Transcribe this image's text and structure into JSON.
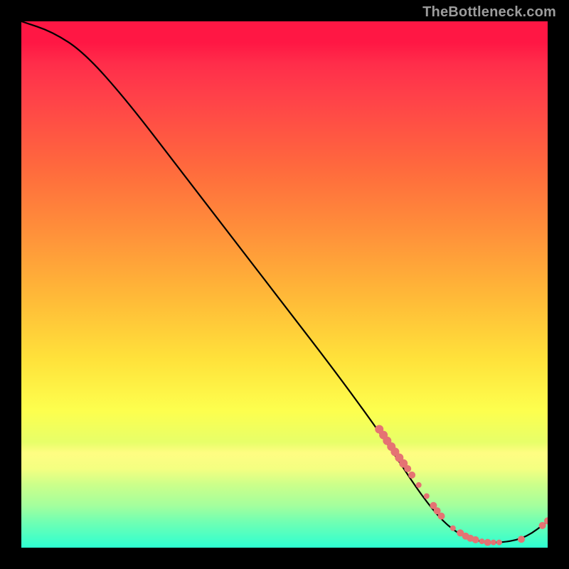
{
  "watermark": "TheBottleneck.com",
  "colors": {
    "background": "#000000",
    "dot": "#e57373",
    "line": "#000000",
    "watermark": "#9c9c9c",
    "gradient_top": "#ff1744",
    "gradient_bottom": "#2effd1"
  },
  "chart_data": {
    "type": "line",
    "title": "",
    "xlabel": "",
    "ylabel": "",
    "xlim": [
      0,
      100
    ],
    "ylim": [
      0,
      100
    ],
    "curve": [
      {
        "x": 0,
        "y": 100
      },
      {
        "x": 6,
        "y": 98
      },
      {
        "x": 12,
        "y": 94
      },
      {
        "x": 20,
        "y": 85
      },
      {
        "x": 30,
        "y": 72
      },
      {
        "x": 40,
        "y": 59
      },
      {
        "x": 50,
        "y": 46
      },
      {
        "x": 60,
        "y": 33
      },
      {
        "x": 68,
        "y": 22
      },
      {
        "x": 72,
        "y": 16
      },
      {
        "x": 76,
        "y": 10
      },
      {
        "x": 80,
        "y": 5
      },
      {
        "x": 84,
        "y": 2
      },
      {
        "x": 88,
        "y": 1
      },
      {
        "x": 92,
        "y": 1
      },
      {
        "x": 96,
        "y": 2
      },
      {
        "x": 100,
        "y": 5
      }
    ],
    "dots": [
      {
        "x": 68.0,
        "y": 22.5,
        "r": 6
      },
      {
        "x": 68.8,
        "y": 21.4,
        "r": 6
      },
      {
        "x": 69.5,
        "y": 20.3,
        "r": 6
      },
      {
        "x": 70.3,
        "y": 19.2,
        "r": 6
      },
      {
        "x": 71.0,
        "y": 18.2,
        "r": 6
      },
      {
        "x": 71.8,
        "y": 17.1,
        "r": 6
      },
      {
        "x": 72.6,
        "y": 16.0,
        "r": 6
      },
      {
        "x": 73.4,
        "y": 15.0,
        "r": 5
      },
      {
        "x": 74.2,
        "y": 13.8,
        "r": 5
      },
      {
        "x": 75.5,
        "y": 11.9,
        "r": 4
      },
      {
        "x": 77.0,
        "y": 9.8,
        "r": 4
      },
      {
        "x": 78.3,
        "y": 8.0,
        "r": 5
      },
      {
        "x": 79.0,
        "y": 7.0,
        "r": 5
      },
      {
        "x": 79.8,
        "y": 6.0,
        "r": 5
      },
      {
        "x": 82.0,
        "y": 3.7,
        "r": 4
      },
      {
        "x": 83.4,
        "y": 2.8,
        "r": 5
      },
      {
        "x": 84.4,
        "y": 2.2,
        "r": 5
      },
      {
        "x": 85.3,
        "y": 1.8,
        "r": 5
      },
      {
        "x": 86.3,
        "y": 1.5,
        "r": 5
      },
      {
        "x": 87.5,
        "y": 1.2,
        "r": 4
      },
      {
        "x": 88.6,
        "y": 1.0,
        "r": 5
      },
      {
        "x": 89.7,
        "y": 1.0,
        "r": 4
      },
      {
        "x": 90.8,
        "y": 1.0,
        "r": 4
      },
      {
        "x": 95.0,
        "y": 1.6,
        "r": 5
      },
      {
        "x": 99.0,
        "y": 4.2,
        "r": 5
      },
      {
        "x": 100.0,
        "y": 5.1,
        "r": 5
      }
    ]
  }
}
